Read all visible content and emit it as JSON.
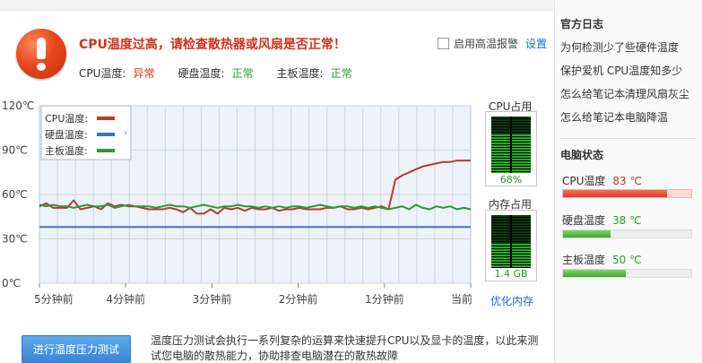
{
  "alert": {
    "title": "CPU温度过高，请检查散热器或风扇是否正常！",
    "alarm_toggle_label": "启用高温报警",
    "settings_label": "设置"
  },
  "status": {
    "cpu_label": "CPU温度:",
    "cpu_value": "异常",
    "disk_label": "硬盘温度:",
    "disk_value": "正常",
    "board_label": "主板温度:",
    "board_value": "正常"
  },
  "chart_data": {
    "type": "line",
    "y_ticks": [
      "120℃",
      "90℃",
      "60℃",
      "30℃",
      "0℃"
    ],
    "x_ticks": [
      "5分钟前",
      "4分钟前",
      "3分钟前",
      "2分钟前",
      "1分钟前",
      "当前"
    ],
    "ylim": [
      0,
      120
    ],
    "legend_position": "top-left",
    "grid": true,
    "series": [
      {
        "name": "CPU温度",
        "color": "#b83b2a",
        "values": [
          52,
          54,
          51,
          51,
          51,
          56,
          50,
          51,
          52,
          50,
          54,
          52,
          53,
          52,
          52,
          51,
          50,
          50,
          50,
          51,
          50,
          48,
          51,
          47,
          47,
          50,
          47,
          51,
          50,
          51,
          49,
          51,
          50,
          50,
          51,
          49,
          50,
          50,
          51,
          50,
          50,
          50,
          51,
          51,
          52,
          50,
          50,
          51,
          50,
          51,
          52,
          50,
          70,
          73,
          75,
          77,
          79,
          80,
          81,
          82,
          82,
          83,
          83,
          83
        ]
      },
      {
        "name": "硬盘温度",
        "color": "#3b73c9",
        "values": [
          38,
          38,
          38,
          38,
          38,
          38,
          38,
          38,
          38,
          38,
          38,
          38,
          38,
          38,
          38,
          38,
          38,
          38,
          38,
          38,
          38,
          38,
          38,
          38,
          38,
          38,
          38,
          38,
          38,
          38,
          38,
          38,
          38,
          38,
          38,
          38,
          38,
          38,
          38,
          38,
          38,
          38,
          38,
          38,
          38,
          38,
          38,
          38,
          38,
          38,
          38,
          38,
          38,
          38,
          38,
          38,
          38,
          38,
          38,
          38,
          38,
          38,
          38,
          38
        ]
      },
      {
        "name": "主板温度",
        "color": "#2a9a35",
        "values": [
          53,
          52,
          53,
          52,
          52,
          51,
          52,
          53,
          52,
          52,
          53,
          51,
          52,
          53,
          52,
          52,
          52,
          51,
          52,
          53,
          52,
          52,
          51,
          52,
          53,
          52,
          51,
          52,
          52,
          53,
          52,
          52,
          51,
          52,
          51,
          52,
          51,
          52,
          52,
          51,
          52,
          53,
          52,
          51,
          52,
          52,
          51,
          52,
          51,
          52,
          51,
          50,
          51,
          52,
          50,
          53,
          51,
          50,
          52,
          51,
          52,
          50,
          51,
          50
        ]
      }
    ]
  },
  "gauges": {
    "cpu_title": "CPU占用",
    "cpu_value": "68%",
    "cpu_fraction": 0.68,
    "mem_title": "内存占用",
    "mem_value": "1.4 GB",
    "mem_fraction": 0.45
  },
  "optimize_memory_label": "优化内存",
  "stress_test": {
    "button_label": "进行温度压力测试",
    "description": "温度压力测试会执行一系列复杂的运算来快速提升CPU以及显卡的温度，以此来测试您电脑的散热能力，协助排查电脑潜在的散热故障"
  },
  "sidebar": {
    "blog_heading": "官方日志",
    "blog_links": [
      "为何检测少了些硬件温度",
      "保护爱机 CPU温度知多少",
      "怎么给笔记本清理风扇灰尘",
      "怎么给笔记本电脑降温"
    ],
    "pc_heading": "电脑状态",
    "pc_status": [
      {
        "label": "CPU温度",
        "value": "83 ℃",
        "fraction": 0.81,
        "tone": "red"
      },
      {
        "label": "硬盘温度",
        "value": "38 ℃",
        "fraction": 0.37,
        "tone": "green"
      },
      {
        "label": "主板温度",
        "value": "50 ℃",
        "fraction": 0.49,
        "tone": "green"
      }
    ]
  },
  "colors": {
    "alert_red": "#d2331c",
    "ok_green": "#2b9a2b",
    "link_blue": "#1a6fc4",
    "chart_bg": "#edf2f8",
    "grid_line": "#c7d7e6"
  }
}
